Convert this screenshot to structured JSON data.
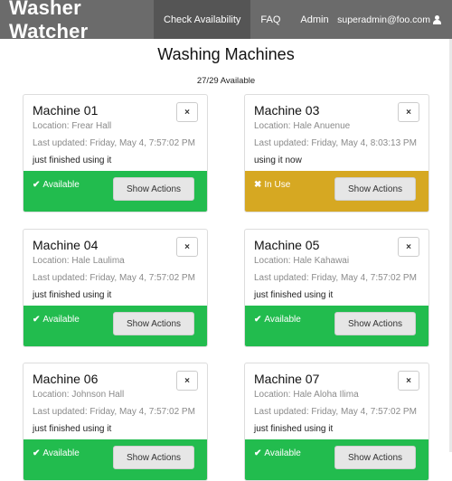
{
  "navbar": {
    "brand": "Washer Watcher",
    "links": [
      {
        "label": "Check Availability",
        "active": true
      },
      {
        "label": "FAQ",
        "active": false
      },
      {
        "label": "Admin",
        "active": false
      }
    ],
    "user": "superadmin@foo.com",
    "user_icon": "user-icon"
  },
  "page": {
    "title": "Washing Machines",
    "availability": "27/29 Available"
  },
  "colors": {
    "available": "#22bc4e",
    "in_use": "#d6a822",
    "navbar": "#6b6b6b"
  },
  "machines": [
    {
      "name": "Machine 01",
      "location": "Location: Frear Hall",
      "updated": "Last updated: Friday, May 4, 7:57:02 PM",
      "note": "just finished using it",
      "status": "Available",
      "status_icon": "check-icon",
      "action": "Show Actions",
      "close": "×"
    },
    {
      "name": "Machine 03",
      "location": "Location: Hale Anuenue",
      "updated": "Last updated: Friday, May 4, 8:03:13 PM",
      "note": "using it now",
      "status": "In Use",
      "status_icon": "x-icon",
      "action": "Show Actions",
      "close": "×"
    },
    {
      "name": "Machine 04",
      "location": "Location: Hale Laulima",
      "updated": "Last updated: Friday, May 4, 7:57:02 PM",
      "note": "just finished using it",
      "status": "Available",
      "status_icon": "check-icon",
      "action": "Show Actions",
      "close": "×"
    },
    {
      "name": "Machine 05",
      "location": "Location: Hale Kahawai",
      "updated": "Last updated: Friday, May 4, 7:57:02 PM",
      "note": "just finished using it",
      "status": "Available",
      "status_icon": "check-icon",
      "action": "Show Actions",
      "close": "×"
    },
    {
      "name": "Machine 06",
      "location": "Location: Johnson Hall",
      "updated": "Last updated: Friday, May 4, 7:57:02 PM",
      "note": "just finished using it",
      "status": "Available",
      "status_icon": "check-icon",
      "action": "Show Actions",
      "close": "×"
    },
    {
      "name": "Machine 07",
      "location": "Location: Hale Aloha Ilima",
      "updated": "Last updated: Friday, May 4, 7:57:02 PM",
      "note": "just finished using it",
      "status": "Available",
      "status_icon": "check-icon",
      "action": "Show Actions",
      "close": "×"
    }
  ]
}
